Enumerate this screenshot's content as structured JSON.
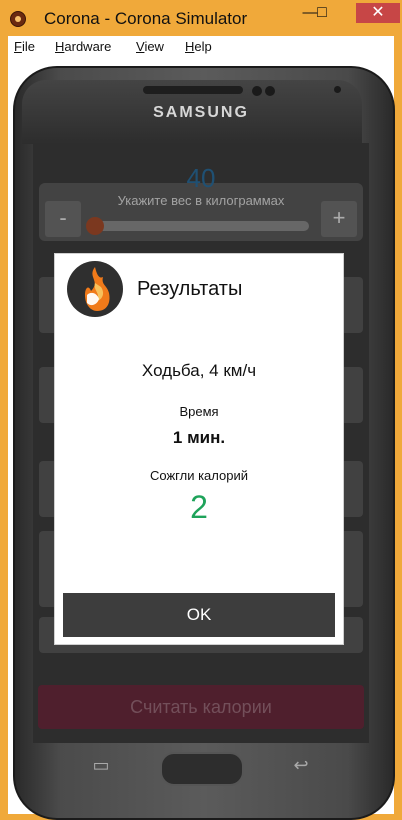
{
  "window": {
    "title": "Corona - Corona Simulator",
    "minimize": "—",
    "maximize": "□",
    "close": "✕",
    "colors": {
      "frame": "#f0a93a",
      "close_button": "#c74646"
    }
  },
  "menu": [
    {
      "key": "F",
      "rest": "ile"
    },
    {
      "key": "H",
      "rest": "ardware"
    },
    {
      "key": "V",
      "rest": "iew"
    },
    {
      "key": "H",
      "rest": "elp"
    }
  ],
  "device": {
    "brand": "SAMSUNG"
  },
  "app_background": {
    "weight_value": "40",
    "weight_label": "Укажите вес в килограммах",
    "minus": "-",
    "plus": "+",
    "calculate_button": "Считать калории"
  },
  "dialog": {
    "title": "Результаты",
    "activity": "Ходьба, 4 км/ч",
    "time_label": "Время",
    "time_value": "1 мин.",
    "calories_label": "Сожгли калорий",
    "calories_value": "2",
    "ok_button": "OK",
    "icon": "flame-muscle-icon",
    "colors": {
      "calories": "#1ea35a",
      "ok": "#3d3d3d"
    }
  },
  "softkeys": {
    "recent": "▭",
    "back": "↩"
  }
}
